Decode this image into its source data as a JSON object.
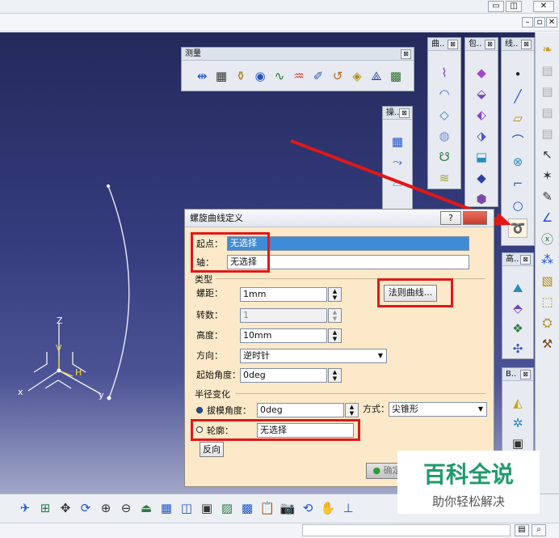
{
  "window": {
    "min_glyph": "▭",
    "restore_glyph": "◫",
    "close_glyph": "✕",
    "inner_glyph_1": "–",
    "inner_glyph_2": "▫",
    "inner_glyph_3": "✕"
  },
  "toolbars": {
    "measure_title": "测量",
    "curve_title": "曲..",
    "surface_title": "包..",
    "wire_title": "线..",
    "ops_title": "操..",
    "adv_title": "高..",
    "b_title": "B..",
    "close_glyph": "⊠"
  },
  "axis": {
    "z": "Z",
    "v": "V",
    "h": "H",
    "x": "x",
    "y": "y"
  },
  "dialog": {
    "title": "螺旋曲线定义",
    "help_glyph": "?",
    "start_label": "起点：",
    "start_value": "无选择",
    "axis_label": "轴：",
    "axis_value": "无选择",
    "type_group": "类型",
    "pitch_label": "螺距：",
    "pitch_value": "1mm",
    "law_button": "法则曲线...",
    "turns_label": "转数：",
    "turns_value": "1",
    "height_label": "高度：",
    "height_value": "10mm",
    "direction_label": "方向：",
    "direction_value": "逆时针",
    "start_angle_label": "起始角度：",
    "start_angle_value": "0deg",
    "radius_group": "半径变化",
    "taper_label": "拔模角度：",
    "taper_value": "0deg",
    "mode_label": "方式：",
    "mode_value": "尖锥形",
    "profile_label": "轮廓：",
    "profile_value": "无选择",
    "reverse_button": "反向",
    "ok_button": "确定"
  },
  "watermark": {
    "title": "百科全说",
    "subtitle": "助你轻松解决"
  },
  "colors": {
    "highlight_red": "#e01818",
    "selection_blue": "#3f8bd8",
    "dialog_bg": "#fbe9c9"
  }
}
